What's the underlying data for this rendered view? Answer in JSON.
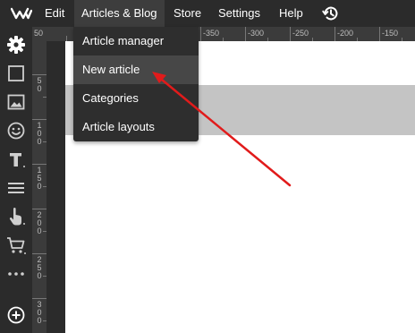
{
  "menubar": {
    "logo_icon": "wave-logo-icon",
    "items": [
      {
        "label": "Edit"
      },
      {
        "label": "Articles & Blog"
      },
      {
        "label": "Store"
      },
      {
        "label": "Settings"
      },
      {
        "label": "Help"
      }
    ],
    "history_icon": "history-icon"
  },
  "dropdown": {
    "items": [
      {
        "label": "Article manager"
      },
      {
        "label": "New article"
      },
      {
        "label": "Categories"
      },
      {
        "label": "Article layouts"
      }
    ],
    "highlighted": "New article"
  },
  "toolbar": {
    "tools": [
      "gear-icon",
      "square-icon",
      "image-icon",
      "smiley-icon",
      "text-icon",
      "menu-lines-icon",
      "hand-pointer-icon",
      "cart-icon",
      "more-dots-icon",
      "add-circle-icon"
    ]
  },
  "ruler_top": {
    "labels": [
      "50",
      "-350",
      "-300",
      "-250",
      "-200",
      "-150"
    ]
  },
  "ruler_left": {
    "labels": [
      "50",
      "100",
      "150",
      "200",
      "250",
      "300"
    ]
  },
  "colors": {
    "menubar_bg": "#2b2b2b",
    "dropdown_bg": "#2e2e2e",
    "dropdown_hover": "#474747",
    "annotation_arrow": "#e11b1b",
    "canvas_band": "#c4c4c4"
  }
}
